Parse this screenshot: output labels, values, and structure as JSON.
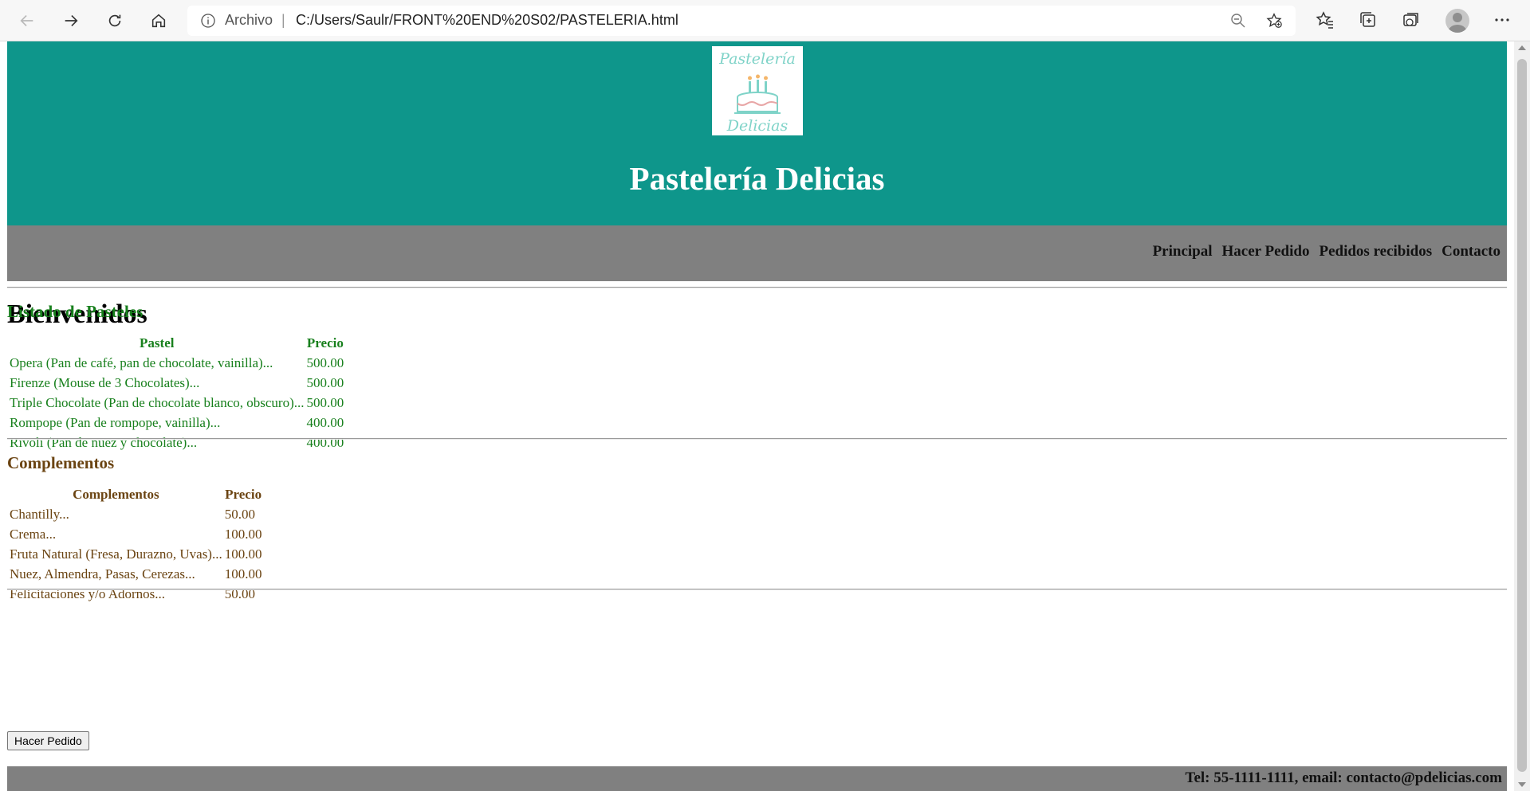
{
  "browser": {
    "address_prefix": "Archivo",
    "address_separator": "|",
    "url": "C:/Users/Saulr/FRONT%20END%20S02/PASTELERIA.html",
    "icons": [
      "back-icon",
      "forward-icon",
      "refresh-icon",
      "home-icon",
      "info-icon",
      "zoom-out-icon",
      "add-favorite-icon",
      "favorites-icon",
      "collections-icon",
      "share-icon",
      "profile-icon",
      "more-icon"
    ]
  },
  "header": {
    "logo_text_top": "Pastelería",
    "logo_text_bottom": "Delicias",
    "title": "Pastelería Delicias",
    "background": "#0e968b"
  },
  "nav": {
    "items": [
      {
        "label": "Principal"
      },
      {
        "label": "Hacer Pedido"
      },
      {
        "label": "Pedidos recibidos"
      },
      {
        "label": "Contacto"
      }
    ],
    "background": "#808080"
  },
  "main": {
    "heading": "Bienvenidos",
    "cakes": {
      "title": "Listado de Pasteles",
      "headers": [
        "Pastel",
        "Precio"
      ],
      "rows": [
        {
          "name": "Opera (Pan de café, pan de chocolate, vainilla)...",
          "price": "500.00"
        },
        {
          "name": "Firenze (Mouse de 3 Chocolates)...",
          "price": "500.00"
        },
        {
          "name": "Triple Chocolate (Pan de chocolate blanco, obscuro)...",
          "price": "500.00"
        },
        {
          "name": "Rompope (Pan de rompope, vainilla)...",
          "price": "400.00"
        },
        {
          "name": "Rivoli (Pan de nuez y chocolate)...",
          "price": "400.00"
        }
      ],
      "color": "#18801d"
    },
    "extras": {
      "title": "Complementos",
      "headers": [
        "Complementos",
        "Precio"
      ],
      "rows": [
        {
          "name": "Chantilly...",
          "price": "50.00"
        },
        {
          "name": "Crema...",
          "price": "100.00"
        },
        {
          "name": "Fruta Natural (Fresa, Durazno, Uvas)...",
          "price": "100.00"
        },
        {
          "name": "Nuez, Almendra, Pasas, Cerezas...",
          "price": "100.00"
        },
        {
          "name": "Felicitaciones y/o Adornos...",
          "price": "50.00"
        }
      ],
      "color": "#6b4412"
    },
    "order_button": "Hacer Pedido"
  },
  "footer": {
    "text": "Tel: 55-1111-1111, email: contacto@pdelicias.com"
  }
}
